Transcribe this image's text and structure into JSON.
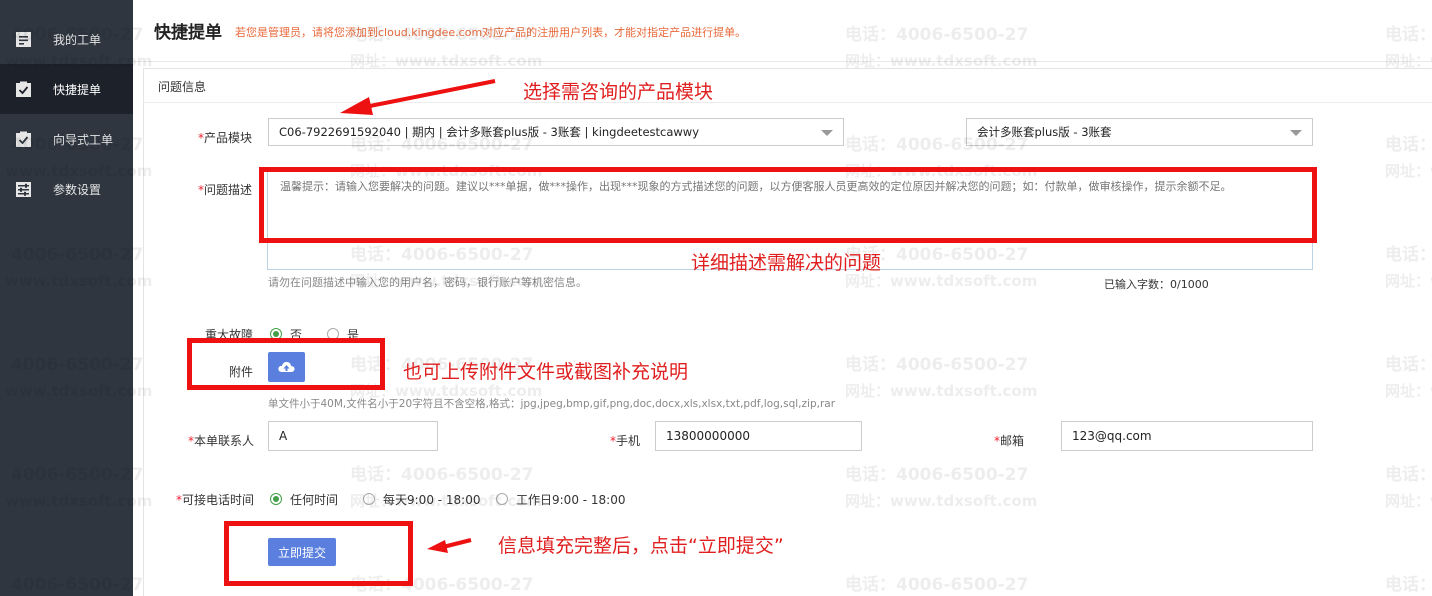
{
  "sidebar": {
    "items": [
      {
        "label": "我的工单",
        "icon": "ticket-list-icon"
      },
      {
        "label": "快捷提单",
        "icon": "clipboard-check-icon"
      },
      {
        "label": "向导式工单",
        "icon": "clipboard-check-icon"
      },
      {
        "label": "参数设置",
        "icon": "settings-sliders-icon"
      }
    ],
    "active_index": 1
  },
  "header": {
    "title": "快捷提单",
    "notice": "若您是管理员，请将您添加到cloud.kingdee.com对应产品的注册用户列表，才能对指定产品进行提单。"
  },
  "section": {
    "title": "问题信息"
  },
  "form": {
    "product": {
      "label": "产品模块",
      "value": "C06-7922691592040 | 期内 | 会计多账套plus版 - 3账套 | kingdeetestcawwy",
      "version_value": "会计多账套plus版 - 3账套"
    },
    "description": {
      "label": "问题描述",
      "placeholder": "温馨提示：请输入您要解决的问题。建议以***单据，做***操作，出现***现象的方式描述您的问题，以方便客服人员更高效的定位原因并解决您的问题；如：付款单，做审核操作，提示余额不足。",
      "hint": "请勿在问题描述中输入您的用户名，密码，银行账户等机密信息。",
      "counter": "已输入字数：0/1000"
    },
    "major_fault": {
      "label": "重大故障",
      "options": [
        "否",
        "是"
      ],
      "selected": "否"
    },
    "attachment": {
      "label": "附件",
      "hint": "单文件小于40M,文件名小于20字符且不含空格,格式：jpg,jpeg,bmp,gif,png,doc,docx,xls,xlsx,txt,pdf,log,sql,zip,rar"
    },
    "contact": {
      "label": "本单联系人",
      "value": "A"
    },
    "phone": {
      "label": "手机",
      "value": "13800000000"
    },
    "email": {
      "label": "邮箱",
      "value": "123@qq.com"
    },
    "call_time": {
      "label": "可接电话时间",
      "options": [
        "任何时间",
        "每天9:00 - 18:00",
        "工作日9:00 - 18:00"
      ],
      "selected": "任何时间"
    },
    "submit_label": "立即提交"
  },
  "annotations": {
    "product": "选择需咨询的产品模块",
    "description": "详细描述需解决的问题",
    "attachment": "也可上传附件文件或截图补充说明",
    "submit": "信息填充完整后，点击“立即提交”"
  },
  "watermark": {
    "phone": "电话：4006-6500-27",
    "site": "网址：www.tdxsoft.com"
  },
  "colors": {
    "sidebar_bg": "#2f3640",
    "sidebar_active": "#1d222a",
    "primary_button": "#5b7fde",
    "annotation_red": "#e02020",
    "notice_orange": "#e8693a",
    "radio_green": "#43a047"
  }
}
